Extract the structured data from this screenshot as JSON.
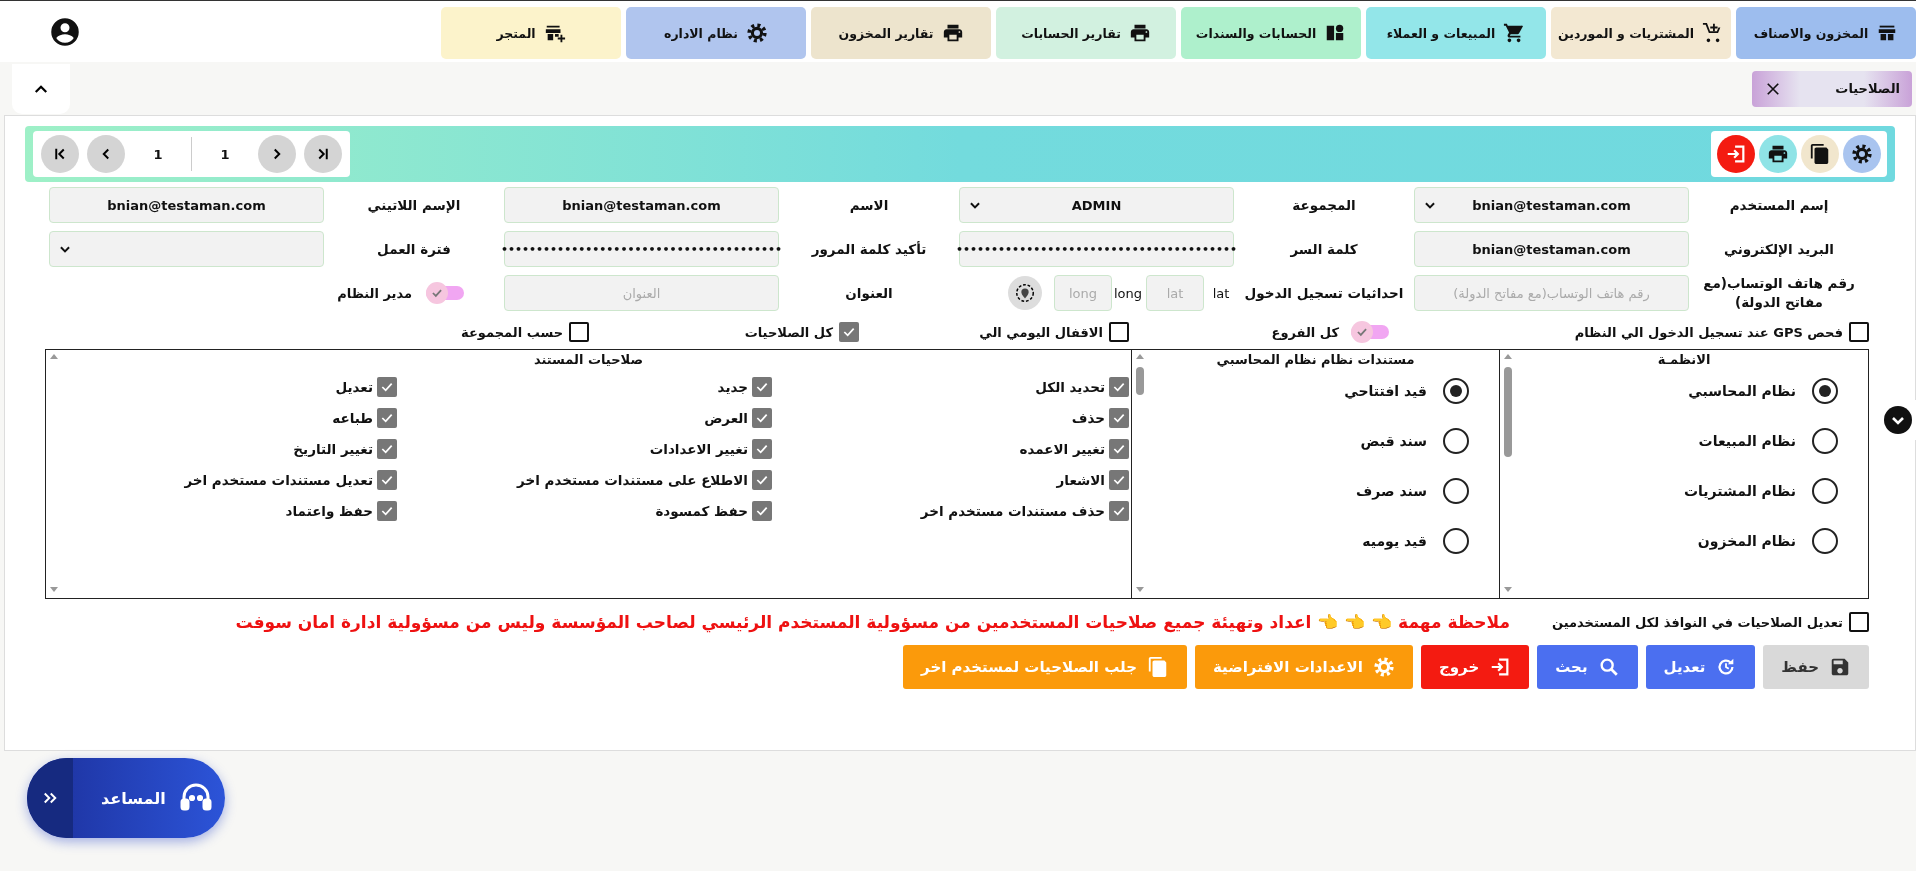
{
  "nav_tabs": [
    {
      "label": "المخزون والاصناف",
      "kind": "store",
      "color": "#9dbdee"
    },
    {
      "label": "المشتريات و الموردين",
      "kind": "cartplus",
      "color": "#f3e8d2"
    },
    {
      "label": "المبيعات و العملاء",
      "kind": "cart",
      "color": "#93e6e9"
    },
    {
      "label": "الحسابات والسندات",
      "kind": "contacts",
      "color": "#aef0cc"
    },
    {
      "label": "تقارير الحسابات",
      "kind": "print",
      "color": "#d2f1e0"
    },
    {
      "label": "تقارير المخزون",
      "kind": "print",
      "color": "#ede4cd"
    },
    {
      "label": "نظام الاداره",
      "kind": "gear",
      "color": "#b0c5ee"
    },
    {
      "label": "المتجر",
      "kind": "storeplus",
      "color": "#fcf3cb"
    }
  ],
  "open_tab": {
    "label": "الصلاحيات"
  },
  "toolbar": [
    {
      "kind": "gear",
      "color": "#a9c4ef"
    },
    {
      "kind": "copy",
      "color": "#f1e6cd"
    },
    {
      "kind": "print",
      "color": "#8fe3e6"
    },
    {
      "kind": "exit",
      "color": "#f41b11"
    }
  ],
  "pager": {
    "current": "1",
    "total": "1"
  },
  "fields": [
    {
      "kind": "label",
      "text": "إسم المستخدم"
    },
    {
      "kind": "select",
      "value": "bnian@testaman.com"
    },
    {
      "kind": "label",
      "text": "المجموعة"
    },
    {
      "kind": "select",
      "value": "ADMIN"
    },
    {
      "kind": "label",
      "text": "الاسم"
    },
    {
      "kind": "text",
      "value": "bnian@testaman.com"
    },
    {
      "kind": "label",
      "text": "الإسم اللاتيني"
    },
    {
      "kind": "text",
      "value": "bnian@testaman.com"
    },
    {
      "kind": "label",
      "text": "البريد الإلكتروني"
    },
    {
      "kind": "text",
      "value": "bnian@testaman.com"
    },
    {
      "kind": "label",
      "text": "كلمة السر"
    },
    {
      "kind": "password",
      "value": "••••••••••••••••••••••••••••••••••••••••"
    },
    {
      "kind": "label",
      "text": "تأكيد كلمة المرور"
    },
    {
      "kind": "password",
      "value": "••••••••••••••••••••••••••••••••••••••••"
    },
    {
      "kind": "label",
      "text": "فترة العمل"
    },
    {
      "kind": "select"
    },
    {
      "kind": "label",
      "text": "رقم هاتف الوتساب(مع مفاتح الدولة)"
    },
    {
      "kind": "placeholder",
      "placeholder": "رقم هاتف الوتساب(مع مفاتح الدولة)"
    },
    {
      "kind": "label",
      "text": "احداثيات تسجيل الدخول"
    },
    {
      "kind": "coords",
      "lat_label": "lat",
      "lat_placeholder": "lat",
      "long_label": "long",
      "long_placeholder": "long"
    },
    {
      "kind": "label",
      "text": "العنوان"
    },
    {
      "kind": "placeholder",
      "placeholder": "العنوان"
    },
    {
      "kind": "toggle",
      "text": "مدير النظام",
      "on": true
    }
  ],
  "options": [
    {
      "kind": "checkbox",
      "label": "فحص GPS عند تسجيل الدخول الي النظام",
      "checked": false
    },
    {
      "kind": "toggle",
      "label": "كل الفروع",
      "on": true
    },
    {
      "kind": "checkbox",
      "label": "الاقفال اليومي الي",
      "checked": false
    },
    {
      "kind": "checkbox",
      "label": "كل الصلاحيات",
      "checked": true
    },
    {
      "kind": "checkbox",
      "label": "حسب المجموعة",
      "checked": false
    }
  ],
  "systems": {
    "title": "الانظمـة",
    "items": [
      {
        "label": "نظام المحاسبي",
        "selected": true
      },
      {
        "label": "نظام المبيعات",
        "selected": false
      },
      {
        "label": "نظام المشتريات",
        "selected": false
      },
      {
        "label": "نظام المخزون",
        "selected": false
      }
    ]
  },
  "documents": {
    "title": "مستندات نظام نظام المحاسبي",
    "items": [
      {
        "label": "قيد افتتاحي",
        "selected": true
      },
      {
        "label": "سند قبض",
        "selected": false
      },
      {
        "label": "سند صرف",
        "selected": false
      },
      {
        "label": "قيد يوميه",
        "selected": false
      }
    ]
  },
  "permissions": {
    "title": "صلاحيات المستند",
    "items": [
      {
        "label": "تحديد الكل",
        "checked": true
      },
      {
        "label": "جديد",
        "checked": true
      },
      {
        "label": "تعديل",
        "checked": true
      },
      {
        "label": "حذف",
        "checked": true
      },
      {
        "label": "العرض",
        "checked": true
      },
      {
        "label": "طباعه",
        "checked": true
      },
      {
        "label": "تغيير الاعمده",
        "checked": true
      },
      {
        "label": "تغيير الاعدادات",
        "checked": true
      },
      {
        "label": "تغيير التاريخ",
        "checked": true
      },
      {
        "label": "الاشعار",
        "checked": true
      },
      {
        "label": "الاطلاع على مستندات مستخدم اخر",
        "checked": true
      },
      {
        "label": "تعديل مستندات مستخدم اخر",
        "checked": true
      },
      {
        "label": "حذف مستندات مستخدم اخر",
        "checked": true
      },
      {
        "label": "حفظ كمسودة",
        "checked": true
      },
      {
        "label": "حفظ واعتماد",
        "checked": true
      }
    ]
  },
  "apply_all": {
    "label": "تعديل الصلاحيات في النوافذ لكل المستخدمين",
    "checked": false
  },
  "note": "ملاحظة مهمة 👈 👈 👈 اعداد وتهيئة جميع صلاحيات المستخدمين من مسؤولية المستخدم الرئيسي لصاحب المؤسسة وليس من مسؤولية ادارة امان سوفت",
  "buttons": [
    {
      "label": "حفظ",
      "kind": "save",
      "color": "#d9d9d9",
      "disabled": true
    },
    {
      "label": "تعديل",
      "kind": "refresh",
      "color": "#4b6ff0",
      "disabled": false
    },
    {
      "label": "بحث",
      "kind": "search",
      "color": "#4b6ff0",
      "disabled": false
    },
    {
      "label": "خروج",
      "kind": "exit",
      "color": "#f41b11",
      "disabled": false
    },
    {
      "label": "الاعدادات الافتراضية",
      "kind": "gear",
      "color": "#fb9a0b",
      "disabled": false
    },
    {
      "label": "جلب الصلاحيات لمستخدم اخر",
      "kind": "copy",
      "color": "#fb9a0b",
      "disabled": false
    }
  ],
  "assistant": {
    "label": "المساعد"
  }
}
